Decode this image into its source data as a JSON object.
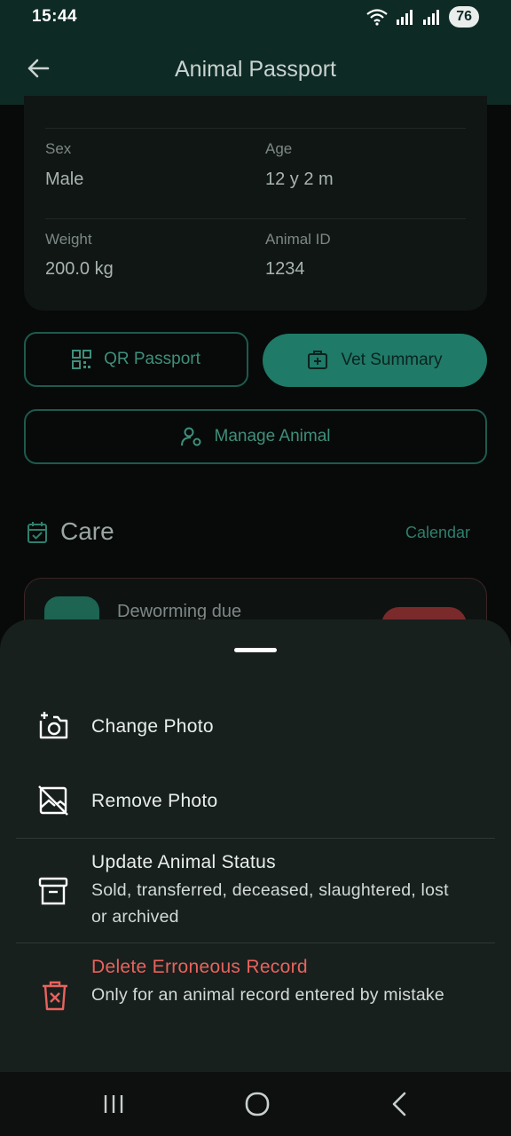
{
  "status_bar": {
    "time": "15:44",
    "battery": "76"
  },
  "app_bar": {
    "title": "Animal Passport"
  },
  "animal_info": {
    "sex_label": "Sex",
    "sex_value": "Male",
    "age_label": "Age",
    "age_value": "12 y 2 m",
    "weight_label": "Weight",
    "weight_value": "200.0 kg",
    "id_label": "Animal ID",
    "id_value": "1234"
  },
  "actions": {
    "qr_passport": "QR Passport",
    "vet_summary": "Vet Summary",
    "manage_animal": "Manage Animal"
  },
  "care": {
    "title": "Care",
    "calendar_link": "Calendar",
    "task_title": "Deworming due"
  },
  "sheet": {
    "change_photo": "Change Photo",
    "remove_photo": "Remove Photo",
    "update_status_title": "Update Animal Status",
    "update_status_sub": "Sold, transferred, deceased, slaughtered, lost or archived",
    "delete_title": "Delete Erroneous Record",
    "delete_sub": "Only for an animal record entered by mistake"
  },
  "colors": {
    "accent": "#1f7a68",
    "danger": "#e8635c",
    "sheet_bg": "#18201e"
  },
  "icons": [
    "wifi-icon",
    "signal-icon",
    "back-arrow-icon",
    "qr-code-icon",
    "vet-icon",
    "manage-user-icon",
    "calendar-check-icon",
    "camera-plus-icon",
    "no-image-icon",
    "archive-icon",
    "delete-icon"
  ]
}
